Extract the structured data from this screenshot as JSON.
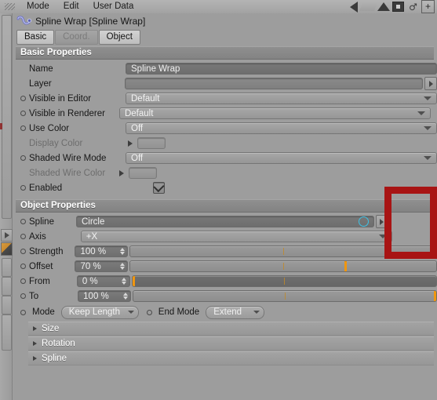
{
  "menubar": {
    "items": [
      "Mode",
      "Edit",
      "User Data"
    ],
    "icons": [
      "grip-dots",
      "back-arrow-icon",
      "ghost-icon",
      "up-arrow-icon",
      "layout-icon",
      "snowman-icon",
      "plus-icon"
    ],
    "plus_label": "+",
    "snowman_label": "♂"
  },
  "object": {
    "icon": "spline-wrap-icon",
    "title": "Spline Wrap [Spline Wrap]"
  },
  "tabs": [
    {
      "label": "Basic",
      "state": "active"
    },
    {
      "label": "Coord.",
      "state": "dim"
    },
    {
      "label": "Object",
      "state": "active"
    }
  ],
  "basic_properties": {
    "title": "Basic Properties",
    "rows": [
      {
        "name": "name",
        "label": "Name",
        "value": "Spline Wrap",
        "type": "text",
        "bullet": false,
        "dim": false
      },
      {
        "name": "layer",
        "label": "Layer",
        "value": "",
        "type": "link",
        "bullet": false,
        "dim": false
      },
      {
        "name": "visible-in-editor",
        "label": "Visible in Editor",
        "value": "Default",
        "type": "combo",
        "bullet": true,
        "dim": false
      },
      {
        "name": "visible-in-renderer",
        "label": "Visible in Renderer",
        "value": "Default",
        "type": "combo",
        "bullet": true,
        "dim": false
      },
      {
        "name": "use-color",
        "label": "Use Color",
        "value": "Off",
        "type": "combo",
        "bullet": true,
        "dim": false
      },
      {
        "name": "display-color",
        "label": "Display Color",
        "value": "",
        "type": "swatch",
        "bullet": false,
        "dim": true
      },
      {
        "name": "shaded-wire-mode",
        "label": "Shaded Wire Mode",
        "value": "Off",
        "type": "combo",
        "bullet": true,
        "dim": false
      },
      {
        "name": "shaded-wire-color",
        "label": "Shaded Wire Color",
        "value": "",
        "type": "swatch",
        "bullet": false,
        "dim": true
      },
      {
        "name": "enabled",
        "label": "Enabled",
        "value": "",
        "type": "checkbox",
        "checked": true,
        "bullet": true,
        "dim": false
      }
    ]
  },
  "object_properties": {
    "title": "Object Properties",
    "spline": {
      "label": "Spline",
      "value": "Circle",
      "icon": "circle-spline-icon"
    },
    "axis": {
      "label": "Axis",
      "value": "+X"
    },
    "sliders": [
      {
        "name": "strength",
        "label": "Strength",
        "value": "100 %",
        "percent": 100,
        "dark": false
      },
      {
        "name": "offset",
        "label": "Offset",
        "value": "70 %",
        "percent": 70,
        "dark": false
      },
      {
        "name": "from",
        "label": "From",
        "value": "0 %",
        "percent": 0,
        "dark": true
      },
      {
        "name": "to",
        "label": "To",
        "value": "100 %",
        "percent": 100,
        "dark": false
      }
    ],
    "mode": {
      "label": "Mode",
      "value": "Keep Length"
    },
    "end_mode": {
      "label": "End Mode",
      "value": "Extend"
    },
    "groups": [
      {
        "name": "size",
        "label": "Size"
      },
      {
        "name": "rotation",
        "label": "Rotation"
      },
      {
        "name": "spline",
        "label": "Spline"
      }
    ]
  },
  "annotation": {
    "name": "red-highlight-box",
    "color": "#a81414"
  }
}
